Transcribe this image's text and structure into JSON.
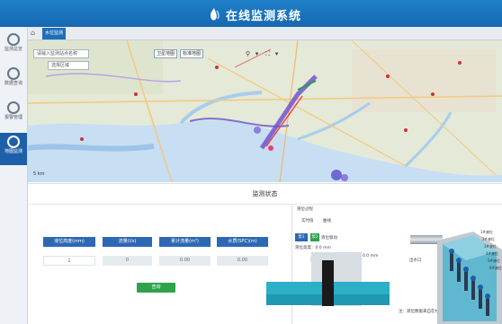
{
  "app": {
    "title": "在线监测系统"
  },
  "sidebar": {
    "items": [
      {
        "label": "监测总览",
        "icon": "gauge-icon"
      },
      {
        "label": "数据查询",
        "icon": "chart-icon"
      },
      {
        "label": "报警管理",
        "icon": "alarm-icon"
      },
      {
        "label": "地图监测",
        "icon": "map-pin-icon",
        "active": true
      }
    ]
  },
  "tabs": {
    "home_icon": "home-icon",
    "active_label": "水位监测"
  },
  "map": {
    "search_placeholder": "请输入监测站点名称",
    "region_select": "选择区域",
    "btn_satellite": "卫星地图",
    "btn_standard": "标准地图",
    "scale_text": "5 km",
    "tools": [
      "⚲",
      "▾",
      "⛶",
      "▾"
    ]
  },
  "panel": {
    "title": "监测状态",
    "metrics": [
      {
        "label": "液位高度(mm)",
        "value": "1"
      },
      {
        "label": "流量(l/s)",
        "value": "0"
      },
      {
        "label": "累计流量(m³)",
        "value": "0.00"
      },
      {
        "label": "水质(SPC)(m)",
        "value": "0.00"
      }
    ],
    "query_btn": "查询"
  },
  "viz": {
    "header": "液位过程",
    "sub_tabs": [
      "实时值",
      "曲线"
    ],
    "mode_btns": [
      "泵1",
      "泵2",
      "液位联动"
    ],
    "level_label": "液位高度：0.0 mm",
    "gauge_label": "测量值：0.0 mm",
    "left_tag": "进水口",
    "right_tag": "出水口",
    "footnote": "注：液位数据来自在线监测仪表",
    "legend": [
      "1#液位",
      "2#液位",
      "3#液位",
      "4#液位",
      "5#液位",
      "6#液位"
    ]
  },
  "colors": {
    "topbar": "#1668b0",
    "button_blue": "#2d68b3",
    "button_green": "#2fa24c",
    "water": "#2bb0c8"
  }
}
